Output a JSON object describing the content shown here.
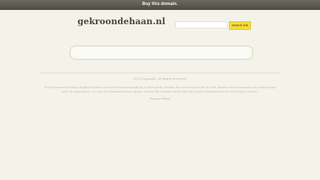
{
  "topbar": {
    "label": "Buy this domain."
  },
  "header": {
    "domain": "gekroondehaan.nl"
  },
  "search": {
    "button_label": "Search Ads",
    "input_value": ""
  },
  "main_search": {
    "value": ""
  },
  "footer": {
    "copyright": "2025 Copyright. All Rights Reserved.",
    "disclaimer": "The Sponsored Listings displayed above are served automatically by a third party. Neither the service provider nor the domain owner maintain any relationship with the advertisers. In case of trademark issues please contact the domain owner directly (contact information can be found in whois).",
    "privacy_label": "Privacy Policy"
  },
  "colors": {
    "background": "#f4f3e9",
    "topbar": "#57524a",
    "search_button": "#f7dc3c"
  }
}
